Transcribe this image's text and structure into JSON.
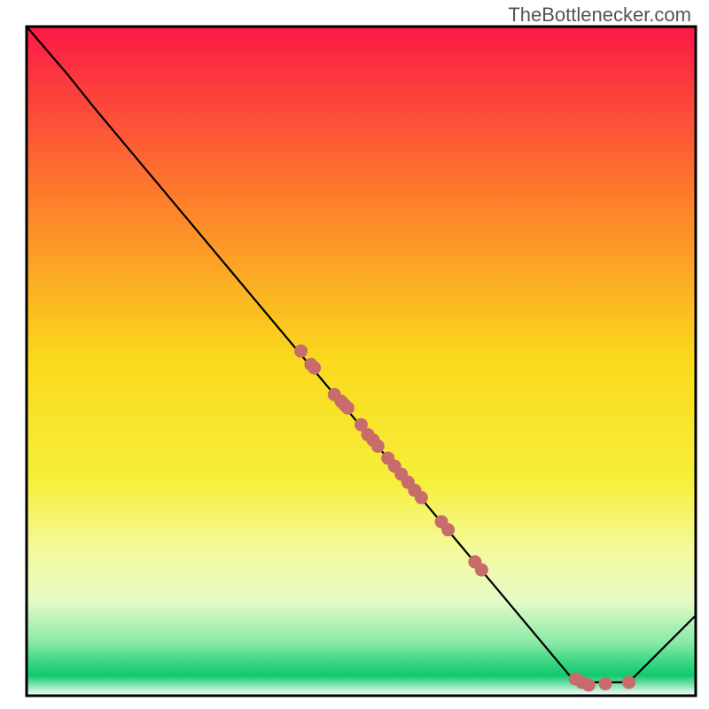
{
  "watermark": "TheBottlenecker.com",
  "chart_data": {
    "type": "line",
    "title": "",
    "xlabel": "",
    "ylabel": "",
    "x_range": [
      0,
      100
    ],
    "y_range": [
      0,
      100
    ],
    "curve": [
      {
        "x": 0,
        "y": 100
      },
      {
        "x": 6,
        "y": 93
      },
      {
        "x": 10,
        "y": 88
      },
      {
        "x": 82,
        "y": 2
      },
      {
        "x": 90,
        "y": 2
      },
      {
        "x": 100,
        "y": 12
      }
    ],
    "scatter_color": "#c86b6b",
    "scatter_points": [
      {
        "x": 41,
        "y": 51.5
      },
      {
        "x": 42.5,
        "y": 49.5
      },
      {
        "x": 43,
        "y": 49
      },
      {
        "x": 46,
        "y": 45
      },
      {
        "x": 47,
        "y": 44
      },
      {
        "x": 47.5,
        "y": 43.5
      },
      {
        "x": 48,
        "y": 43
      },
      {
        "x": 50,
        "y": 40.5
      },
      {
        "x": 51,
        "y": 39
      },
      {
        "x": 51.8,
        "y": 38.2
      },
      {
        "x": 52.5,
        "y": 37.3
      },
      {
        "x": 54,
        "y": 35.5
      },
      {
        "x": 55,
        "y": 34.3
      },
      {
        "x": 56,
        "y": 33.1
      },
      {
        "x": 57,
        "y": 31.9
      },
      {
        "x": 58,
        "y": 30.7
      },
      {
        "x": 59,
        "y": 29.6
      },
      {
        "x": 62,
        "y": 26
      },
      {
        "x": 63,
        "y": 24.8
      },
      {
        "x": 67,
        "y": 20
      },
      {
        "x": 68,
        "y": 18.8
      },
      {
        "x": 82,
        "y": 2.5
      },
      {
        "x": 83,
        "y": 2
      },
      {
        "x": 84,
        "y": 1.6
      },
      {
        "x": 86.5,
        "y": 1.8
      },
      {
        "x": 90,
        "y": 2
      }
    ],
    "background": {
      "type": "vertical_gradient",
      "stops": [
        {
          "pos": 0.0,
          "color": "#fc1947"
        },
        {
          "pos": 0.25,
          "color": "#fd7b2c"
        },
        {
          "pos": 0.5,
          "color": "#fada1c"
        },
        {
          "pos": 0.68,
          "color": "#f6ef3b"
        },
        {
          "pos": 0.78,
          "color": "#f5f99b"
        },
        {
          "pos": 0.86,
          "color": "#e4fac7"
        },
        {
          "pos": 0.92,
          "color": "#8ae9a8"
        },
        {
          "pos": 0.955,
          "color": "#2dd37d"
        },
        {
          "pos": 0.97,
          "color": "#12c96f"
        },
        {
          "pos": 1.0,
          "color": "#ffffff"
        }
      ]
    }
  }
}
